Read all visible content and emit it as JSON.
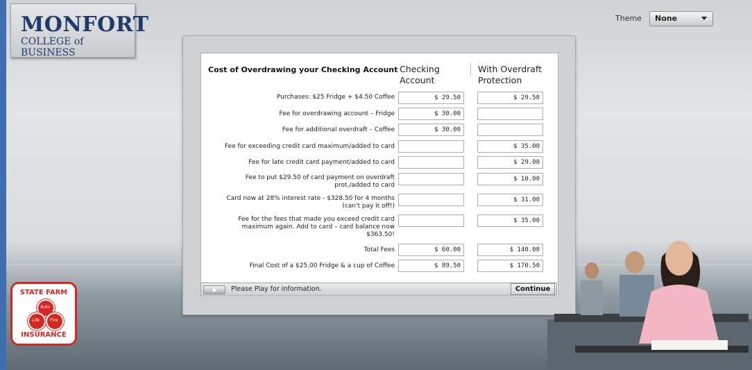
{
  "header": {
    "logo_line1": "MONFORT",
    "logo_line2": "COLLEGE of BUSINESS",
    "theme_label": "Theme",
    "theme_value": "None"
  },
  "table": {
    "title": "Cost of Overdrawing your Checking Account",
    "col1": "Checking Account",
    "col2": "With Overdraft Protection",
    "rows": [
      {
        "label": "Purchases: $25 Fridge + $4.50 Coffee",
        "checking": "$ 29.50",
        "overdraft": "$ 29.50"
      },
      {
        "label": "Fee for overdrawing account – Fridge",
        "checking": "$ 30.00",
        "overdraft": ""
      },
      {
        "label": "Fee for additional overdraft – Coffee",
        "checking": "$ 30.00",
        "overdraft": ""
      },
      {
        "label": "Fee for exceeding credit card maximum/added to card",
        "checking": "",
        "overdraft": "$ 35.00"
      },
      {
        "label": "Fee for late credit card payment/added to card",
        "checking": "",
        "overdraft": "$ 29.00"
      },
      {
        "label": "Fee to put $29.50 of card payment on overdraft prot./added to card",
        "checking": "",
        "overdraft": "$ 10.00"
      },
      {
        "label": "Card now at 28% interest rate - $328.50 for 4 months (can't pay it off!)",
        "checking": "",
        "overdraft": "$ 31.00"
      },
      {
        "label": "Fee for the fees that made you exceed credit card maximum again.  Add to card – card balance now $363.50!",
        "checking": "",
        "overdraft": "$ 35.00"
      },
      {
        "label": "Total Fees",
        "checking": "$ 60.00",
        "overdraft": "$ 140.00"
      },
      {
        "label": "Final Cost of a $25.00 Fridge & a cup of Coffee",
        "checking": "$ 89.50",
        "overdraft": "$ 170.50"
      }
    ]
  },
  "player": {
    "message": "Please Play for information.",
    "continue_label": "Continue"
  },
  "sponsor": {
    "top": "STATE FARM",
    "bottom": "INSURANCE",
    "auto": "Auto",
    "life": "Life",
    "fire": "Fire"
  },
  "colors": {
    "brand_red": "#d5261f",
    "navy": "#1f3b6b",
    "frame_blue": "#3d6fb0"
  }
}
